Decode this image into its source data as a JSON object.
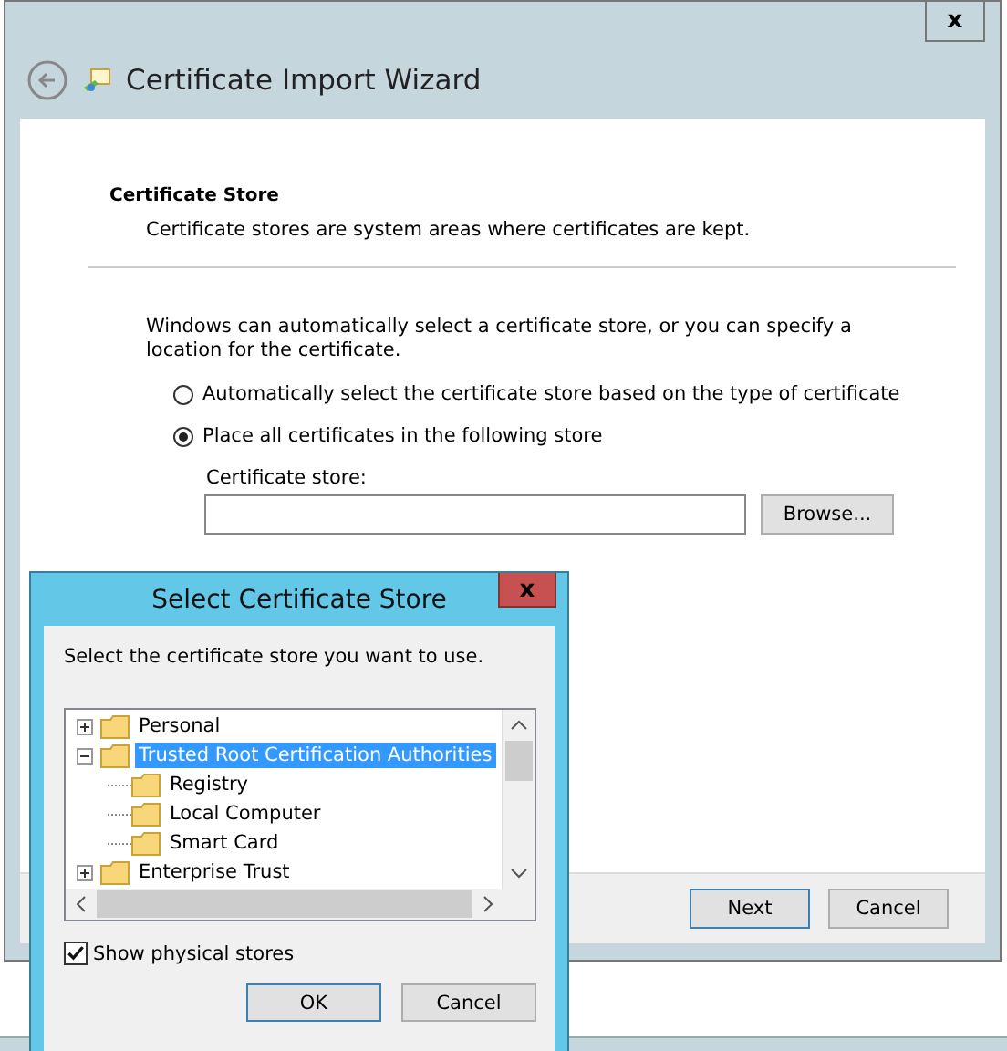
{
  "wizard": {
    "title": "Certificate Import Wizard",
    "close": "x",
    "section_title": "Certificate Store",
    "section_description": "Certificate stores are system areas where certificates are kept.",
    "instructions": "Windows can automatically select a certificate store, or you can specify a location for the certificate.",
    "options": [
      {
        "label": "Automatically select the certificate store based on the type of certificate",
        "selected": false
      },
      {
        "label": "Place all certificates in the following store",
        "selected": true
      }
    ],
    "store_label": "Certificate store:",
    "browse_button": "Browse...",
    "buttons": [
      "Next",
      "Cancel"
    ]
  },
  "dialog": {
    "title": "Select Certificate Store",
    "close": "x",
    "prompt": "Select the certificate store you want to use.",
    "tree": [
      {
        "label": "Personal",
        "expanded": false,
        "selected": false
      },
      {
        "label": "Trusted Root Certification Authorities",
        "expanded": true,
        "selected": true,
        "children": [
          {
            "label": "Registry",
            "selected": false
          },
          {
            "label": "Local Computer",
            "selected": false
          },
          {
            "label": "Smart Card",
            "selected": false
          }
        ]
      },
      {
        "label": "Enterprise Trust",
        "expanded": false,
        "selected": false
      }
    ],
    "show_physical": {
      "label": "Show physical stores",
      "checked": true
    },
    "buttons": [
      "OK",
      "Cancel"
    ]
  }
}
